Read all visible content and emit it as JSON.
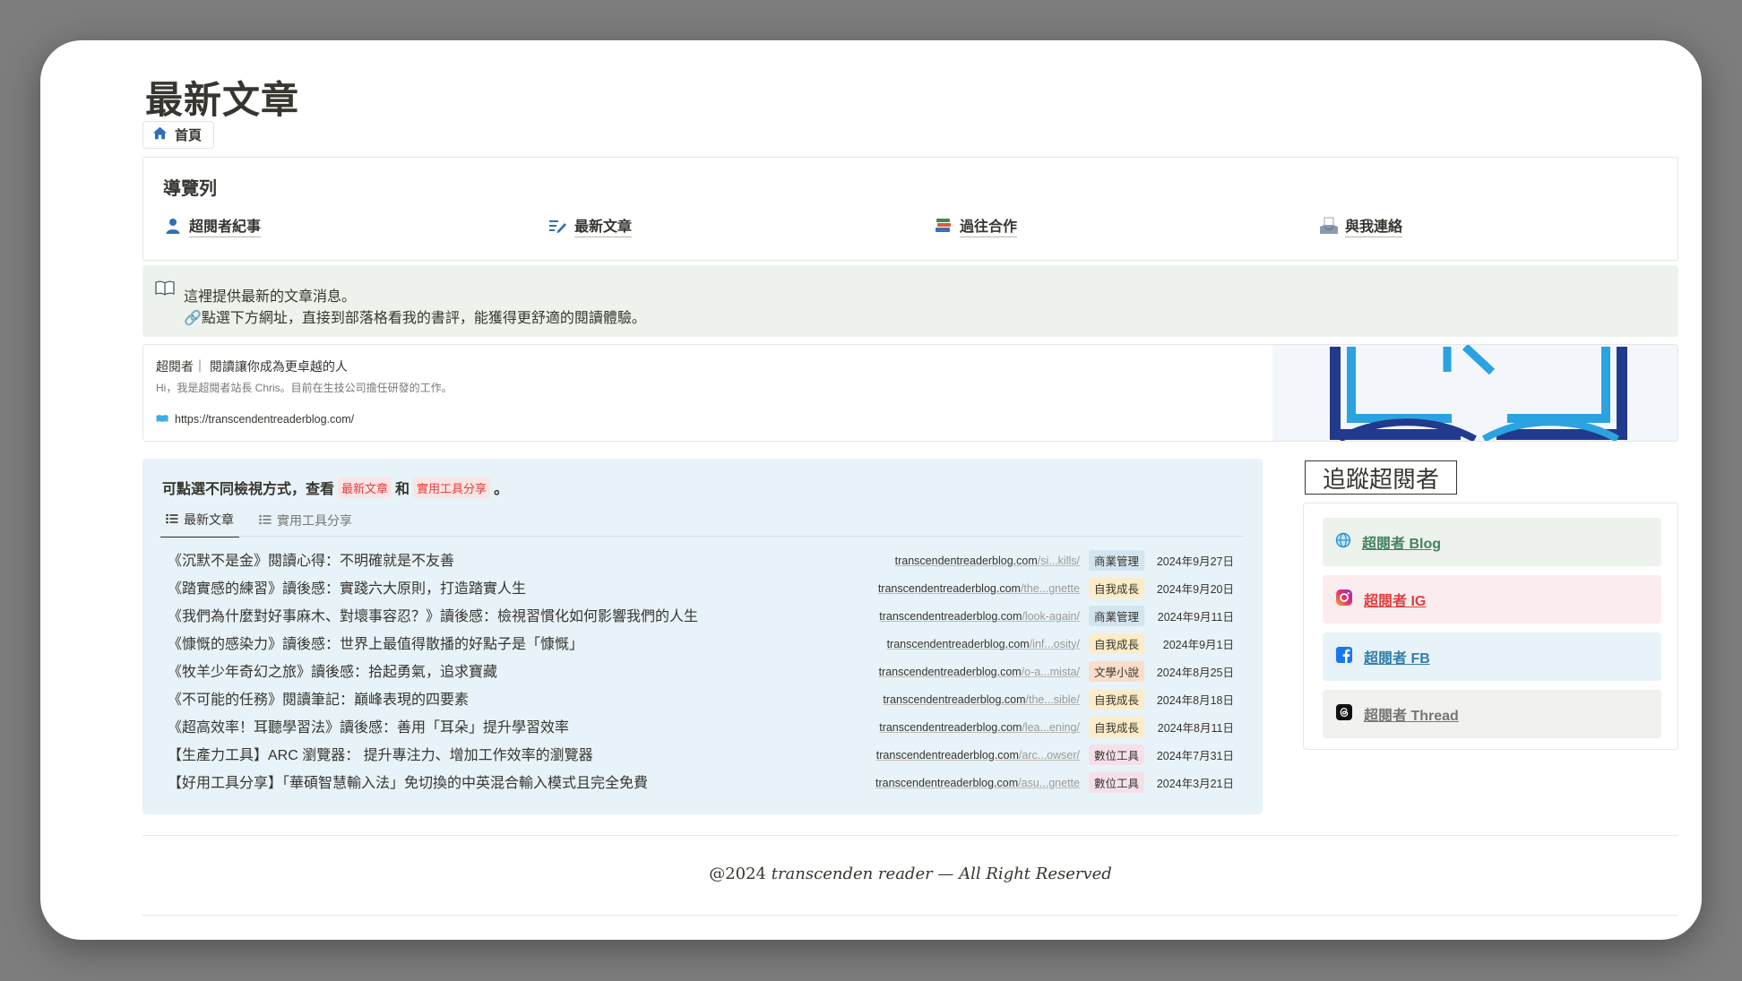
{
  "page": {
    "title": "最新文章",
    "breadcrumb": "首頁"
  },
  "navbar": {
    "title": "導覽列",
    "items": [
      {
        "label": "超閱者紀事",
        "icon": "person-icon"
      },
      {
        "label": "最新文章",
        "icon": "edit-list-icon"
      },
      {
        "label": "過往合作",
        "icon": "books-icon"
      },
      {
        "label": "與我連絡",
        "icon": "inbox-tray-icon"
      }
    ]
  },
  "callout": {
    "icon": "open-book-icon",
    "line1": "這裡提供最新的文章消息。",
    "line2": "🔗點選下方網址，直接到部落格看我的書評，能獲得更舒適的閱讀體驗。"
  },
  "bookmark": {
    "title": "超閱者｜ 閱讀讓你成為更卓越的人",
    "description": "Hi，我是超閱者站長 Chris。目前在生技公司擔任研發的工作。",
    "url": "https://transcendentreaderblog.com/"
  },
  "articles": {
    "heading_prefix": "可點選不同檢視方式，查看",
    "heading_tag1": "最新文章",
    "heading_and": "和",
    "heading_tag2": "實用工具分享",
    "heading_suffix": "。",
    "tabs": [
      {
        "label": "最新文章",
        "active": true
      },
      {
        "label": "實用工具分享",
        "active": false
      }
    ],
    "rows": [
      {
        "title": "《沉默不是金》閱讀心得：不明確就是不友善",
        "domain": "transcendentreaderblog.com",
        "path": "/si...kills/",
        "tag": "商業管理",
        "tag_bg": "#d3e5ef",
        "date": "2024年9月27日"
      },
      {
        "title": "《踏實感的練習》讀後感：實踐六大原則，打造踏實人生",
        "domain": "transcendentreaderblog.com",
        "path": "/the...gnette",
        "tag": "自我成長",
        "tag_bg": "#fdecc8",
        "date": "2024年9月20日"
      },
      {
        "title": "《我們為什麼對好事麻木、對壞事容忍？》讀後感：檢視習慣化如何影響我們的人生",
        "domain": "transcendentreaderblog.com",
        "path": "/look-again/",
        "tag": "商業管理",
        "tag_bg": "#d3e5ef",
        "date": "2024年9月11日"
      },
      {
        "title": "《慷慨的感染力》讀後感：世界上最值得散播的好點子是「慷慨」",
        "domain": "transcendentreaderblog.com",
        "path": "/inf...osity/",
        "tag": "自我成長",
        "tag_bg": "#fdecc8",
        "date": "2024年9月1日"
      },
      {
        "title": "《牧羊少年奇幻之旅》讀後感：拾起勇氣，追求寶藏",
        "domain": "transcendentreaderblog.com",
        "path": "/o-a...mista/",
        "tag": "文學小說",
        "tag_bg": "#fadec9",
        "date": "2024年8月25日"
      },
      {
        "title": "《不可能的任務》閱讀筆記：巔峰表現的四要素",
        "domain": "transcendentreaderblog.com",
        "path": "/the...sible/",
        "tag": "自我成長",
        "tag_bg": "#fdecc8",
        "date": "2024年8月18日"
      },
      {
        "title": "《超高效率！耳聽學習法》讀後感：善用「耳朵」提升學習效率",
        "domain": "transcendentreaderblog.com",
        "path": "/lea...ening/",
        "tag": "自我成長",
        "tag_bg": "#fdecc8",
        "date": "2024年8月11日"
      },
      {
        "title": "【生產力工具】ARC 瀏覽器： 提升專注力、增加工作效率的瀏覽器",
        "domain": "transcendentreaderblog.com",
        "path": "/arc...owser/",
        "tag": "數位工具",
        "tag_bg": "#f5e0e9",
        "date": "2024年7月31日"
      },
      {
        "title": "【好用工具分享】「華碩智慧輸入法」免切換的中英混合輸入模式且完全免費",
        "domain": "transcendentreaderblog.com",
        "path": "/asu...gnette",
        "tag": "數位工具",
        "tag_bg": "#f5e0e9",
        "date": "2024年3月21日"
      }
    ]
  },
  "follow": {
    "title": "追蹤超閱者",
    "links": [
      {
        "label": "超閱者 Blog",
        "icon": "globe-icon",
        "bg": "#edf3ec",
        "color": "#448361"
      },
      {
        "label": "超閱者 IG",
        "icon": "instagram-icon",
        "bg": "#fbecee",
        "color": "#e03e3e"
      },
      {
        "label": "超閱者 FB",
        "icon": "facebook-icon",
        "bg": "#e7f3f8",
        "color": "#337ea9"
      },
      {
        "label": "超閱者 Thread",
        "icon": "threads-icon",
        "bg": "#f1f1ef",
        "color": "#787774"
      }
    ]
  },
  "footer": {
    "prefix": "@2024 ",
    "italic": "transcenden reader",
    "suffix": "  —  All Right Reserved"
  }
}
